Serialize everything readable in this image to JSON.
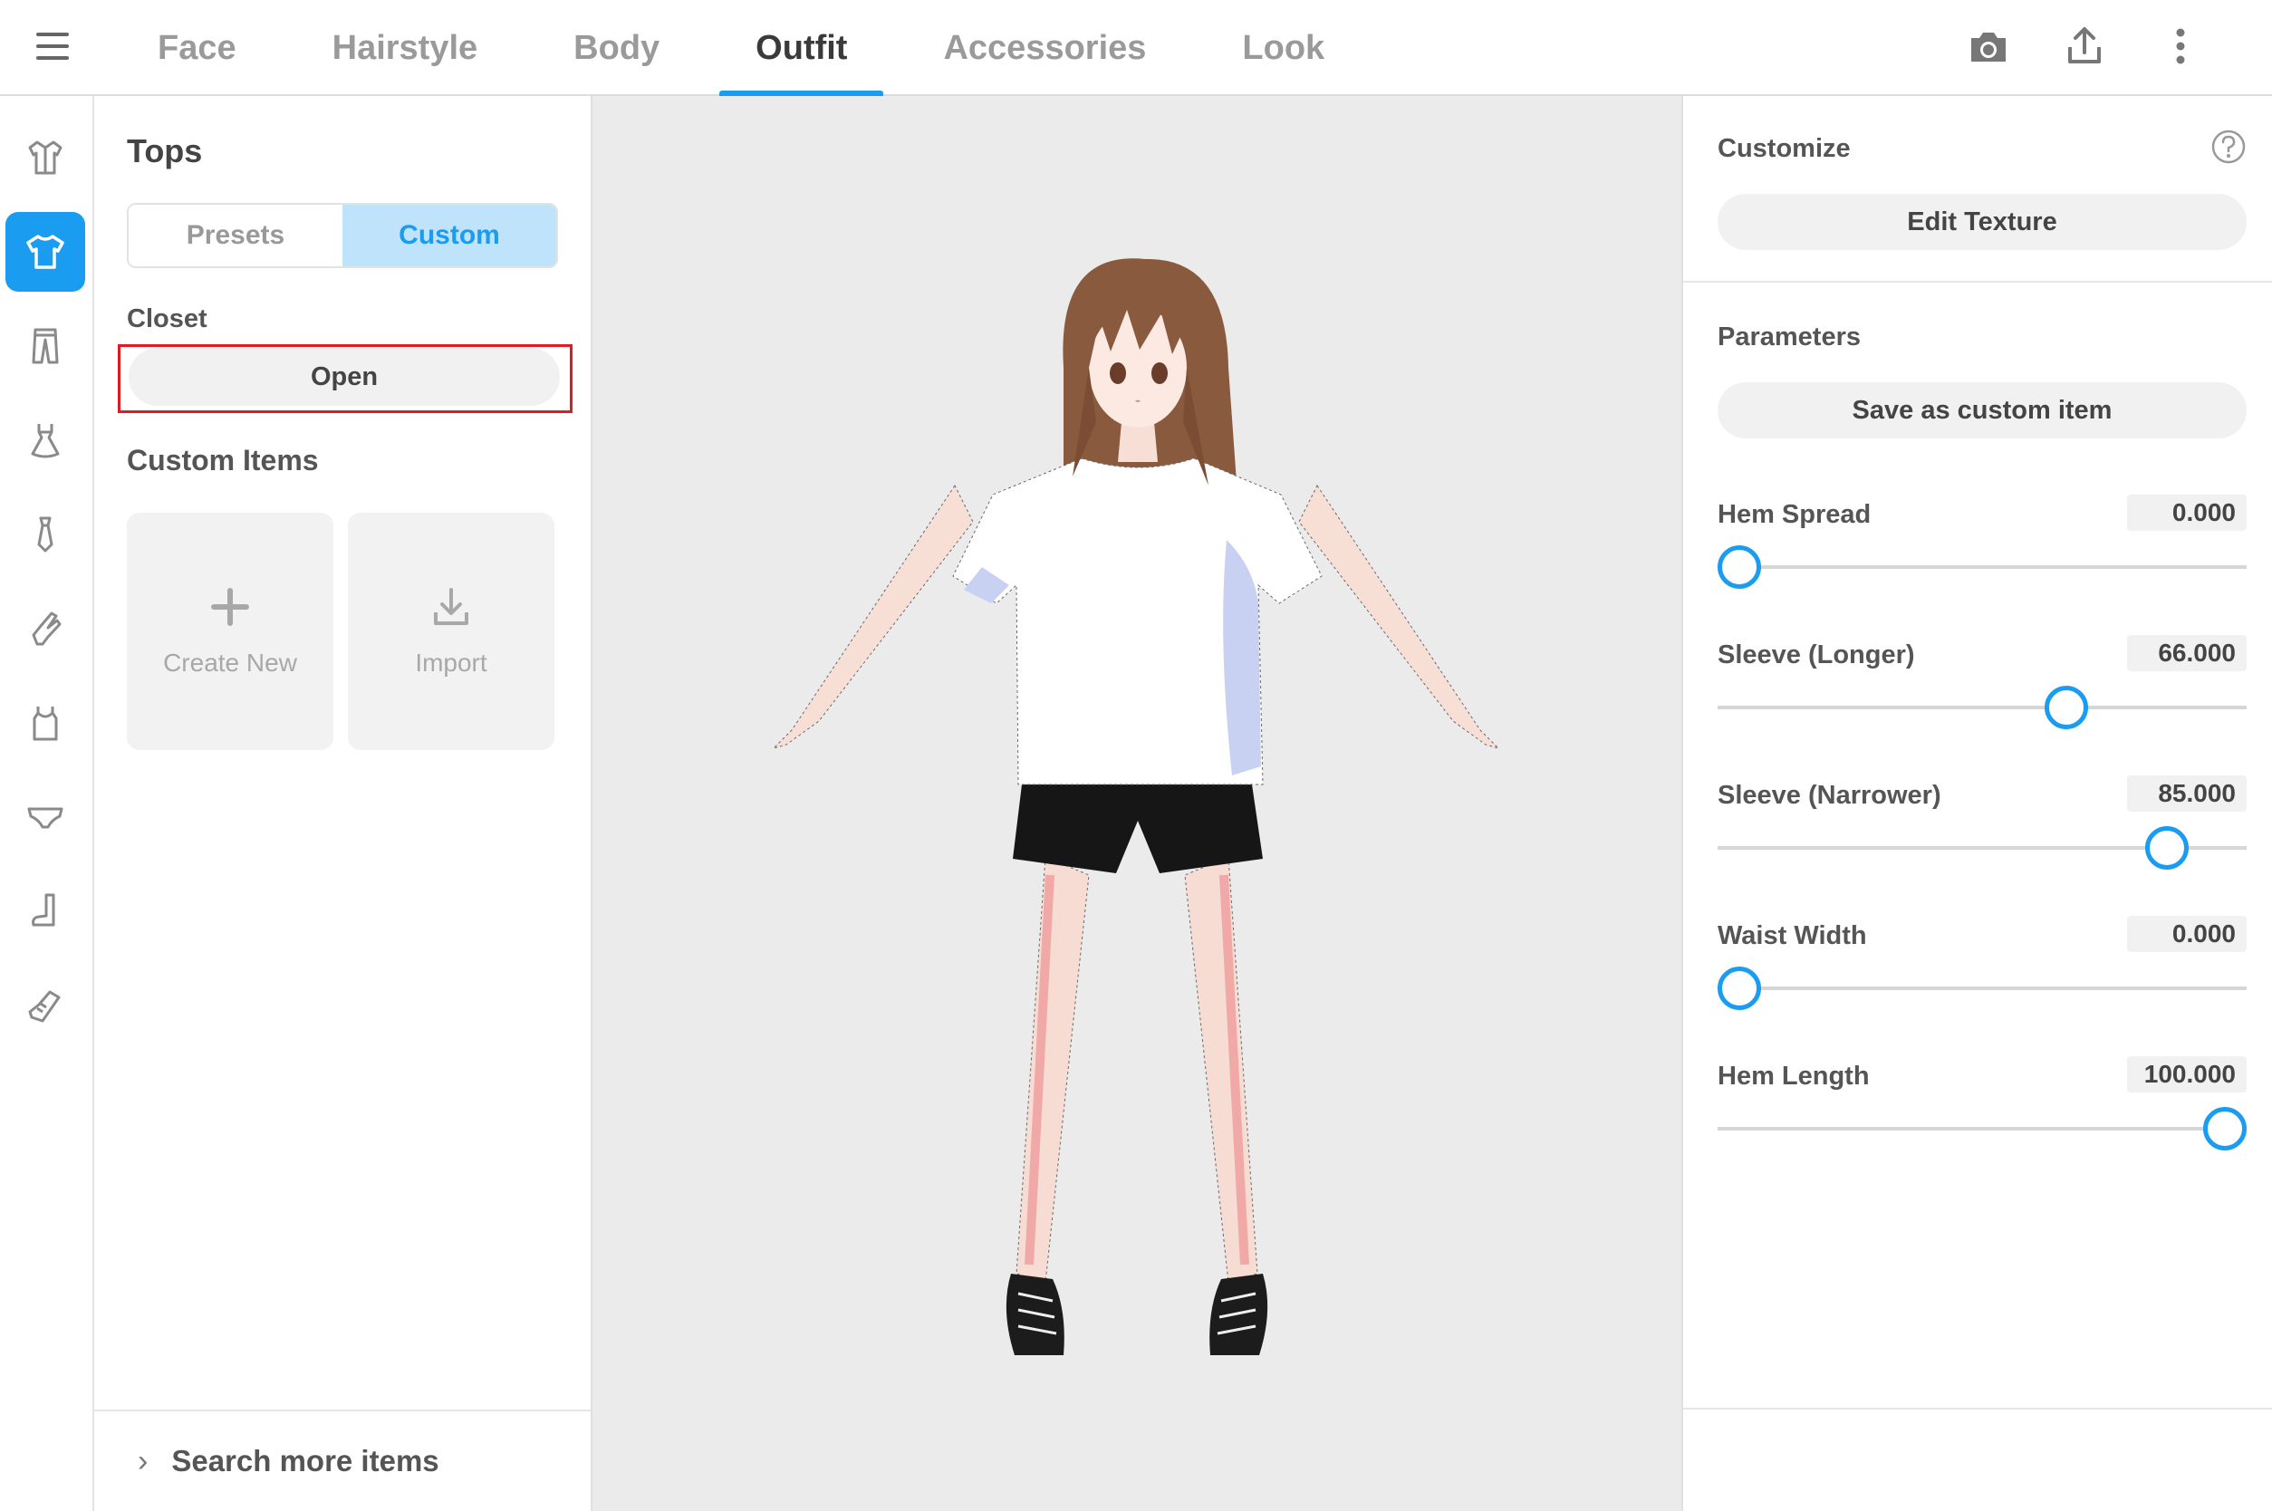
{
  "tabs": [
    {
      "label": "Face",
      "active": false
    },
    {
      "label": "Hairstyle",
      "active": false
    },
    {
      "label": "Body",
      "active": false
    },
    {
      "label": "Outfit",
      "active": true
    },
    {
      "label": "Accessories",
      "active": false
    },
    {
      "label": "Look",
      "active": false
    }
  ],
  "top_icons": [
    "camera-icon",
    "share-icon",
    "more-vert-icon"
  ],
  "rail_icons": [
    {
      "name": "outerwear-icon",
      "active": false
    },
    {
      "name": "tshirt-icon",
      "active": true
    },
    {
      "name": "pants-icon",
      "active": false
    },
    {
      "name": "dress-icon",
      "active": false
    },
    {
      "name": "tie-icon",
      "active": false
    },
    {
      "name": "gloves-icon",
      "active": false
    },
    {
      "name": "tank-top-icon",
      "active": false
    },
    {
      "name": "underwear-icon",
      "active": false
    },
    {
      "name": "socks-icon",
      "active": false
    },
    {
      "name": "shoes-icon",
      "active": false
    }
  ],
  "left_panel": {
    "title": "Tops",
    "segment": {
      "presets": "Presets",
      "custom": "Custom",
      "selected": "Custom"
    },
    "closet_label": "Closet",
    "open_button": "Open",
    "custom_items_label": "Custom Items",
    "create_new": "Create New",
    "import": "Import",
    "search_more": "Search more items"
  },
  "right_panel": {
    "customize_title": "Customize",
    "edit_texture": "Edit Texture",
    "parameters_title": "Parameters",
    "save_custom": "Save as custom item",
    "params": [
      {
        "name": "Hem Spread",
        "value": "0.000",
        "fraction": 0.0
      },
      {
        "name": "Sleeve (Longer)",
        "value": "66.000",
        "fraction": 0.66
      },
      {
        "name": "Sleeve (Narrower)",
        "value": "85.000",
        "fraction": 0.85
      },
      {
        "name": "Waist Width",
        "value": "0.000",
        "fraction": 0.0
      },
      {
        "name": "Hem Length",
        "value": "100.000",
        "fraction": 1.0
      }
    ]
  },
  "colors": {
    "accent": "#1a9cf0",
    "highlight": "#e01b24"
  }
}
